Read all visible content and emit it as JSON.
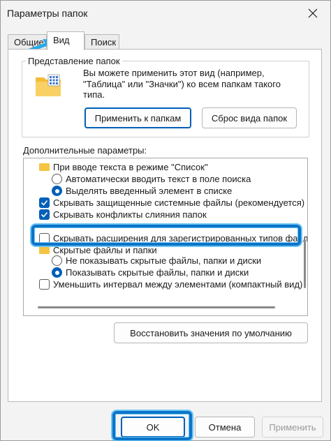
{
  "window": {
    "title": "Параметры папок",
    "close_icon": "close-icon"
  },
  "tabs": [
    {
      "label": "Общие",
      "active": false
    },
    {
      "label": "Вид",
      "active": true
    },
    {
      "label": "Поиск",
      "active": false
    }
  ],
  "folder_views": {
    "group_label": "Представление папок",
    "icon": "folder-view-icon",
    "description": "Вы можете применить этот вид (например, \"Таблица\" или \"Значки\") ко всем папкам такого типа.",
    "apply_button": "Применить к папкам",
    "reset_button": "Сброс вида папок"
  },
  "advanced": {
    "group_label": "Дополнительные параметры:",
    "items": [
      {
        "type": "folder",
        "text": "При вводе текста в режиме \"Список\""
      },
      {
        "type": "radio",
        "checked": false,
        "text": "Автоматически вводить текст в поле поиска"
      },
      {
        "type": "radio",
        "checked": true,
        "text": "Выделять введенный элемент в списке"
      },
      {
        "type": "checkbox",
        "checked": true,
        "text": "Скрывать защищенные системные файлы (рекомендуется)"
      },
      {
        "type": "checkbox",
        "checked": true,
        "text": "Скрывать конфликты слияния папок"
      },
      {
        "type": "checkbox",
        "checked": false,
        "text": "Скрывать расширения для зарегистрированных типов файлов"
      },
      {
        "type": "folder",
        "text": "Скрытые файлы и папки"
      },
      {
        "type": "radio",
        "checked": false,
        "text": "Не показывать скрытые файлы, папки и диски"
      },
      {
        "type": "radio",
        "checked": true,
        "text": "Показывать скрытые файлы, папки и диски"
      },
      {
        "type": "checkbox",
        "checked": false,
        "text": "Уменьшить интервал между элементами (компактный вид)"
      }
    ],
    "restore_button": "Восстановить значения по умолчанию"
  },
  "footer": {
    "ok": "OK",
    "cancel": "Отмена",
    "apply": "Применить"
  },
  "colors": {
    "accent": "#005fb8",
    "highlight": "#0a74c8",
    "annotation_arrow": "#29a8e8"
  }
}
